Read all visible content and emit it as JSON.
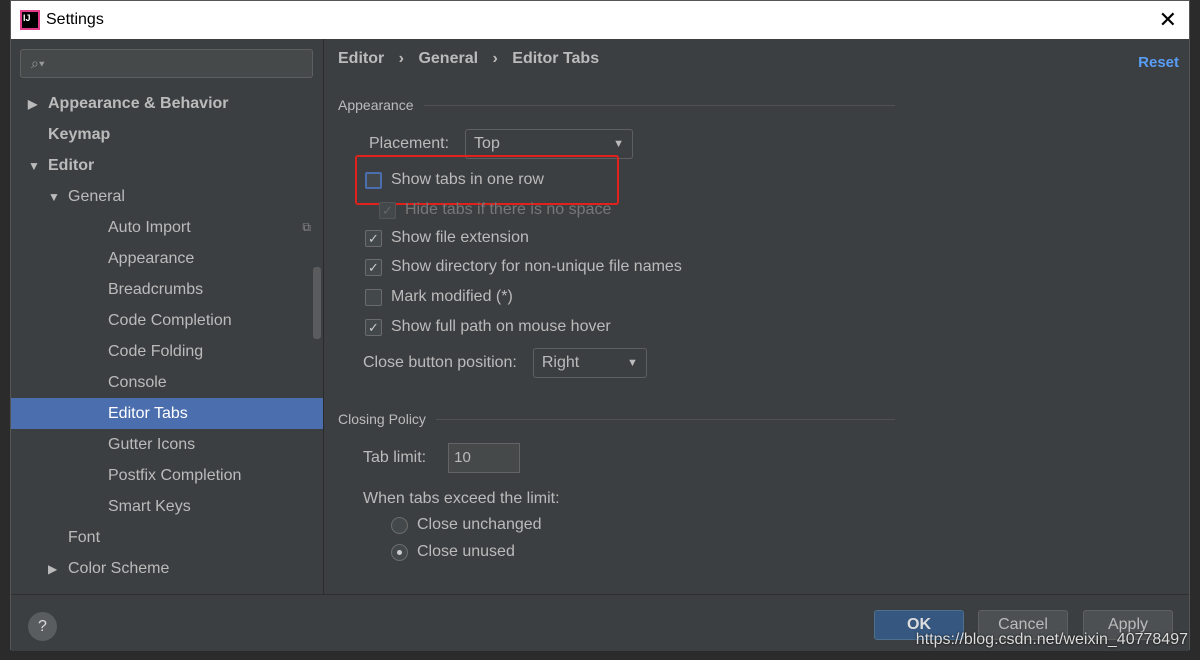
{
  "window": {
    "title": "Settings"
  },
  "sidebar": {
    "search_placeholder": "",
    "items": [
      {
        "label": "Appearance & Behavior",
        "level": 0,
        "arrow": "▶",
        "bold": true
      },
      {
        "label": "Keymap",
        "level": 0,
        "arrow": "",
        "bold": true
      },
      {
        "label": "Editor",
        "level": 0,
        "arrow": "▼",
        "bold": true
      },
      {
        "label": "General",
        "level": 1,
        "arrow": "▼"
      },
      {
        "label": "Auto Import",
        "level": 2,
        "arrow": ""
      },
      {
        "label": "Appearance",
        "level": 2,
        "arrow": ""
      },
      {
        "label": "Breadcrumbs",
        "level": 2,
        "arrow": ""
      },
      {
        "label": "Code Completion",
        "level": 2,
        "arrow": ""
      },
      {
        "label": "Code Folding",
        "level": 2,
        "arrow": ""
      },
      {
        "label": "Console",
        "level": 2,
        "arrow": ""
      },
      {
        "label": "Editor Tabs",
        "level": 2,
        "arrow": "",
        "selected": true
      },
      {
        "label": "Gutter Icons",
        "level": 2,
        "arrow": ""
      },
      {
        "label": "Postfix Completion",
        "level": 2,
        "arrow": ""
      },
      {
        "label": "Smart Keys",
        "level": 2,
        "arrow": ""
      },
      {
        "label": "Font",
        "level": 1,
        "arrow": ""
      },
      {
        "label": "Color Scheme",
        "level": 1,
        "arrow": "▶"
      }
    ]
  },
  "breadcrumb": {
    "a": "Editor",
    "b": "General",
    "c": "Editor Tabs",
    "sep": "›"
  },
  "reset": "Reset",
  "appearance": {
    "title": "Appearance",
    "placement_label": "Placement:",
    "placement_value": "Top",
    "show_one_row": "Show tabs in one row",
    "hide_tabs": "Hide tabs if there is no space",
    "show_ext": "Show file extension",
    "show_dir": "Show directory for non-unique file names",
    "mark_mod": "Mark modified (*)",
    "full_path": "Show full path on mouse hover",
    "close_pos_label": "Close button position:",
    "close_pos_value": "Right"
  },
  "closing": {
    "title": "Closing Policy",
    "tab_limit_label": "Tab limit:",
    "tab_limit": "10",
    "exceed_label": "When tabs exceed the limit:",
    "opt1": "Close unchanged",
    "opt2": "Close unused"
  },
  "footer": {
    "ok": "OK",
    "cancel": "Cancel",
    "apply": "Apply",
    "help": "?"
  },
  "watermark": "https://blog.csdn.net/weixin_40778497"
}
